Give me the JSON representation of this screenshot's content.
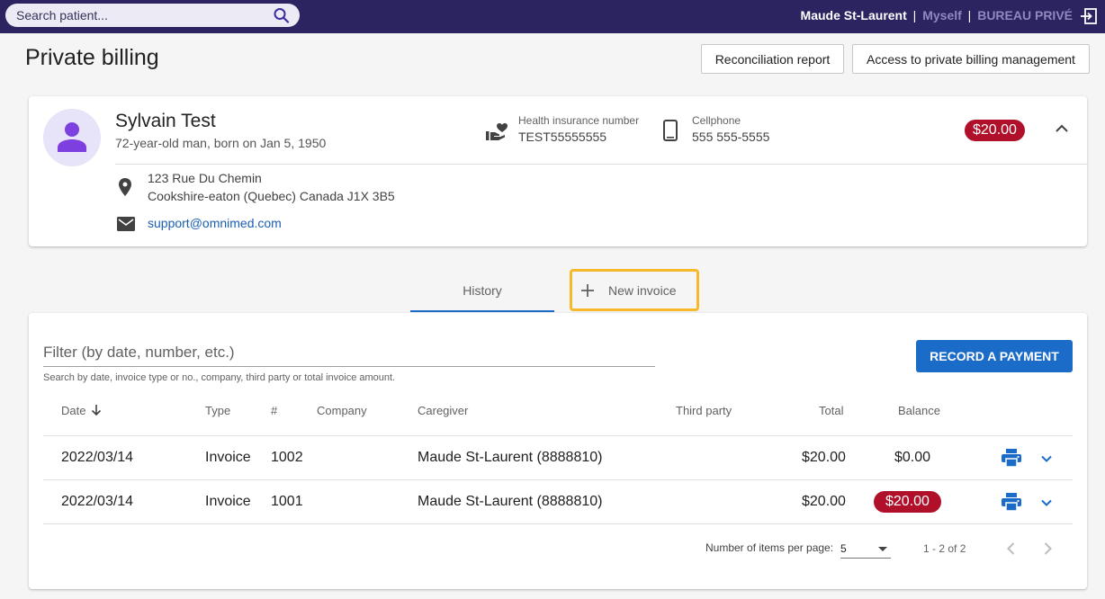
{
  "topbar": {
    "search_placeholder": "Search patient...",
    "user_name": "Maude St-Laurent",
    "separator": "|",
    "context_myself": "Myself",
    "context_office": "BUREAU PRIVÉ",
    "colors": {
      "background": "#2b2461",
      "muted": "#8e89bf"
    }
  },
  "page": {
    "title": "Private billing",
    "reconciliation_button": "Reconciliation report",
    "access_management_button": "Access to private billing management"
  },
  "patient": {
    "name": "Sylvain Test",
    "info": "72-year-old man, born on Jan 5, 1950",
    "health_insurance_label": "Health insurance number",
    "health_insurance_value": "TEST55555555",
    "cellphone_label": "Cellphone",
    "cellphone_value": "555 555-5555",
    "balance": "$20.00",
    "address_line1": "123 Rue Du Chemin",
    "address_line2": "Cookshire-eaton (Quebec) Canada J1X 3B5",
    "email": "support@omnimed.com"
  },
  "tabs": {
    "history": "History",
    "new_invoice": "New invoice"
  },
  "invoices": {
    "filter_placeholder": "Filter (by date, number, etc.)",
    "filter_hint": "Search by date, invoice type or no., company, third party or total invoice amount.",
    "record_payment_button": "RECORD A PAYMENT",
    "columns": {
      "date": "Date",
      "type": "Type",
      "number": "#",
      "company": "Company",
      "caregiver": "Caregiver",
      "third_party": "Third party",
      "total": "Total",
      "balance": "Balance"
    },
    "rows": [
      {
        "date": "2022/03/14",
        "type": "Invoice",
        "number": "1002",
        "company": "",
        "caregiver": "Maude St-Laurent (8888810)",
        "third_party": "",
        "total": "$20.00",
        "balance": "$0.00",
        "balance_due": false
      },
      {
        "date": "2022/03/14",
        "type": "Invoice",
        "number": "1001",
        "company": "",
        "caregiver": "Maude St-Laurent (8888810)",
        "third_party": "",
        "total": "$20.00",
        "balance": "$20.00",
        "balance_due": true
      }
    ],
    "pagination": {
      "items_per_page_label": "Number of items per page:",
      "items_per_page_value": "5",
      "range": "1 - 2 of 2"
    }
  },
  "colors": {
    "accent": "#1b6bc8",
    "danger": "#b0102a",
    "highlight": "#f7b82a",
    "avatar_bg": "#e7e3f8",
    "avatar_icon": "#7e3fe0"
  }
}
